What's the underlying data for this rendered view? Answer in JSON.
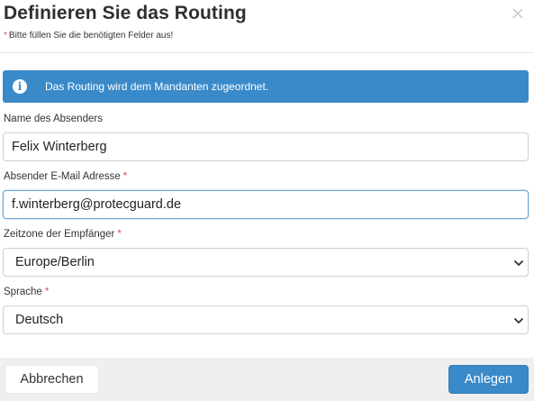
{
  "dialog": {
    "title": "Definieren Sie das Routing",
    "required_note": "Bitte füllen Sie die benötigten Felder aus!",
    "required_star": "*"
  },
  "info": {
    "icon": "info-circle-icon",
    "text": "Das Routing wird dem Mandanten zugeordnet."
  },
  "form": {
    "sender_name": {
      "label": "Name des Absenders",
      "value": "Felix Winterberg"
    },
    "sender_email": {
      "label": "Absender E-Mail Adresse",
      "required": "*",
      "value": "f.winterberg@protecguard.de"
    },
    "timezone": {
      "label": "Zeitzone der Empfänger",
      "required": "*",
      "value": "Europe/Berlin"
    },
    "language": {
      "label": "Sprache",
      "required": "*",
      "value": "Deutsch"
    }
  },
  "footer": {
    "cancel_label": "Abbrechen",
    "create_label": "Anlegen"
  },
  "colors": {
    "accent": "#3a8ac9",
    "required": "#d9534f",
    "footer_bg": "#efefef"
  }
}
